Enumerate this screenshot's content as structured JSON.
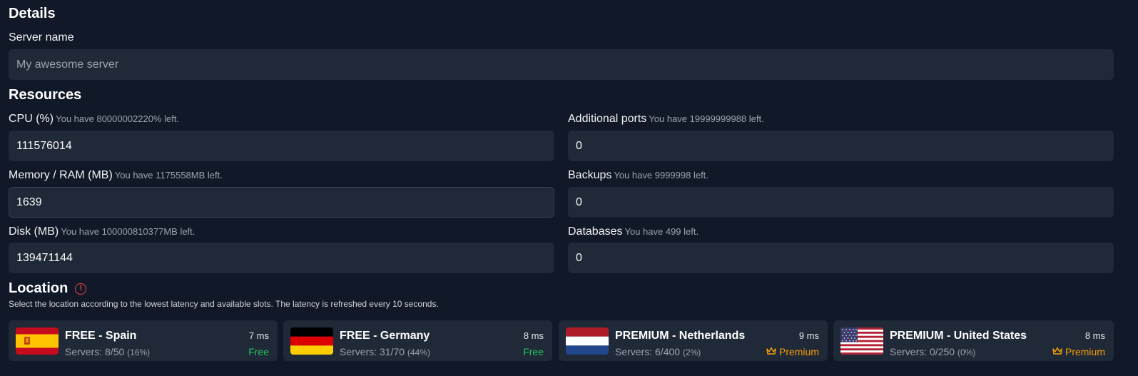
{
  "details": {
    "heading": "Details",
    "server_name_label": "Server name",
    "server_name_placeholder": "My awesome server"
  },
  "resources": {
    "heading": "Resources",
    "cpu": {
      "label": "CPU (%)",
      "hint": "You have 80000002220% left.",
      "value": "111576014"
    },
    "memory": {
      "label": "Memory / RAM (MB)",
      "hint": "You have 1175558MB left.",
      "value": "1639"
    },
    "disk": {
      "label": "Disk (MB)",
      "hint": "You have 100000810377MB left.",
      "value": "139471144"
    },
    "ports": {
      "label": "Additional ports",
      "hint": "You have 19999999988 left.",
      "value": "0"
    },
    "backups": {
      "label": "Backups",
      "hint": "You have 9999998 left.",
      "value": "0"
    },
    "databases": {
      "label": "Databases",
      "hint": "You have 499 left.",
      "value": "0"
    }
  },
  "location": {
    "heading": "Location",
    "warning_icon": "exclamation-circle-icon",
    "warning_color": "#ef4444",
    "description": "Select the location according to the lowest latency and available slots. The latency is refreshed every 10 seconds.",
    "cards": [
      {
        "name": "FREE - Spain",
        "latency": "7 ms",
        "servers": "Servers: 8/50",
        "pct": "(16%)",
        "tier": "Free",
        "flag": "spain-flag-icon"
      },
      {
        "name": "FREE - Germany",
        "latency": "8 ms",
        "servers": "Servers: 31/70",
        "pct": "(44%)",
        "tier": "Free",
        "flag": "germany-flag-icon"
      },
      {
        "name": "PREMIUM - Netherlands",
        "latency": "9 ms",
        "servers": "Servers: 6/400",
        "pct": "(2%)",
        "tier": "Premium",
        "flag": "netherlands-flag-icon"
      },
      {
        "name": "PREMIUM - United States",
        "latency": "8 ms",
        "servers": "Servers: 0/250",
        "pct": "(0%)",
        "tier": "Premium",
        "flag": "usa-flag-icon"
      }
    ]
  },
  "colors": {
    "background": "#111827",
    "input_bg": "#1f2937",
    "free": "#22c55e",
    "premium": "#f59e0b"
  }
}
